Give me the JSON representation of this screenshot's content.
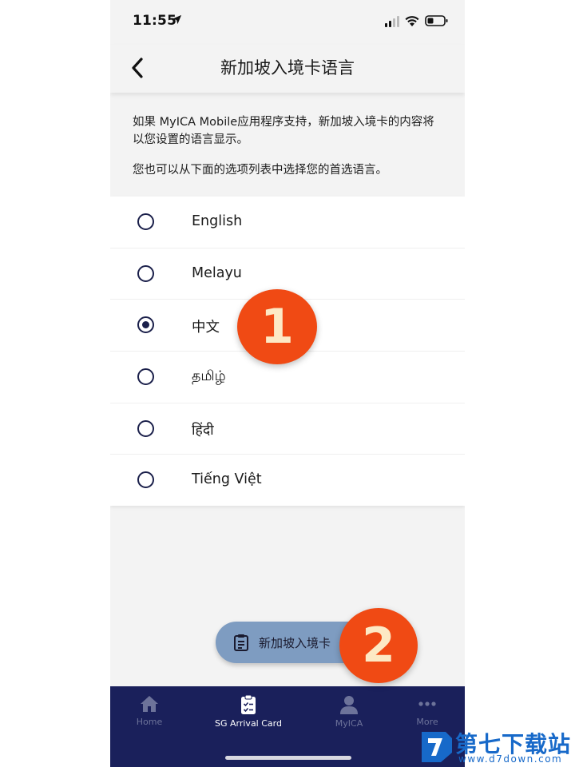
{
  "status_bar": {
    "time": "11:55",
    "icons": [
      "location-arrow-icon",
      "signal-icon",
      "wifi-icon",
      "battery-icon"
    ]
  },
  "header": {
    "back_icon": "chevron-left-icon",
    "title": "新加坡入境卡语言"
  },
  "description": {
    "paragraph1": "如果 MyICA Mobile应用程序支持，新加坡入境卡的内容将以您设置的语言显示。",
    "paragraph2": "您也可以从下面的选项列表中选择您的首选语言。"
  },
  "languages": {
    "selected": "中文",
    "options": [
      {
        "label": "English",
        "checked": false
      },
      {
        "label": "Melayu",
        "checked": false
      },
      {
        "label": "中文",
        "checked": true
      },
      {
        "label": "தமிழ்",
        "checked": false
      },
      {
        "label": "हिंदी",
        "checked": false
      },
      {
        "label": "Tiếng Việt",
        "checked": false
      }
    ]
  },
  "fab": {
    "icon": "clipboard-icon",
    "label": "新加坡入境卡"
  },
  "annotations": {
    "badge1": "1",
    "badge2": "2"
  },
  "bottom_nav": {
    "items": [
      {
        "label": "Home",
        "icon": "home-icon",
        "active": false
      },
      {
        "label": "SG Arrival Card",
        "icon": "clipboard-check-icon",
        "active": true
      },
      {
        "label": "MyICA",
        "icon": "person-icon",
        "active": false
      },
      {
        "label": "More",
        "icon": "more-dots-icon",
        "active": false
      }
    ]
  },
  "watermark": {
    "title": "第七下载站",
    "url": "www.d7down.com"
  },
  "colors": {
    "navy": "#1a205b",
    "fab": "#7e9cc1",
    "badge": "#f04a14",
    "watermark_blue": "#1769c9"
  }
}
